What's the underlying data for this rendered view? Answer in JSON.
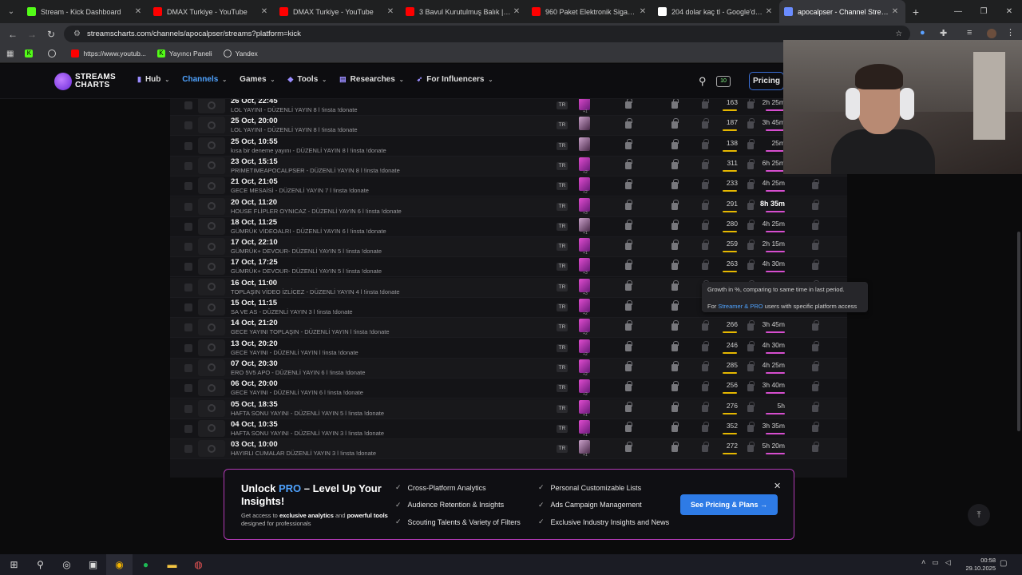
{
  "browser": {
    "tabs": [
      {
        "title": "Stream - Kick Dashboard",
        "color": "#53fc18"
      },
      {
        "title": "DMAX Turkiye - YouTube",
        "color": "#ff0000"
      },
      {
        "title": "DMAX Turkiye - YouTube",
        "color": "#ff0000"
      },
      {
        "title": "3 Bavul Kurutulmuş Balık | Güm",
        "color": "#ff0000"
      },
      {
        "title": "960 Paket Elektronik Sigara Tüt",
        "color": "#ff0000"
      },
      {
        "title": "204 dolar kaç tl - Google'da Ar",
        "color": "#ffffff"
      },
      {
        "title": "apocalpser - Channel Streams",
        "color": "#6a8cff"
      }
    ],
    "url": "streamscharts.com/channels/apocalpser/streams?platform=kick",
    "bookmarks": [
      "https://www.youtub...",
      "Yayıncı Paneli",
      "Yandex"
    ]
  },
  "header": {
    "logo_line1": "STREAMS",
    "logo_line2": "CHARTS",
    "nav": [
      {
        "label": "Hub",
        "icon": "bar-chart-icon"
      },
      {
        "label": "Channels",
        "icon": ""
      },
      {
        "label": "Games",
        "icon": ""
      },
      {
        "label": "Tools",
        "icon": "diamond-icon"
      },
      {
        "label": "Researches",
        "icon": "document-icon"
      },
      {
        "label": "For Influencers",
        "icon": "rocket-icon"
      }
    ],
    "badge": "10",
    "pricing": "Pricing"
  },
  "streams": [
    {
      "date": "26 Oct, 22:45",
      "title": "LOL YAYINI - DÜZENLİ YAYIN 8 l !insta !donate",
      "lang": "TR",
      "games": "+1",
      "viewers": "163",
      "duration": "2h 25m"
    },
    {
      "date": "25 Oct, 20:00",
      "title": "LOL YAYINI - DÜZENLİ YAYIN 8 l !insta !donate",
      "lang": "TR",
      "games": "",
      "viewers": "187",
      "duration": "3h 45m"
    },
    {
      "date": "25 Oct, 10:55",
      "title": "kısa bir deneme yayını - DÜZENLİ YAYIN 8 l !insta !donate",
      "lang": "TR",
      "games": "",
      "viewers": "138",
      "duration": "25m"
    },
    {
      "date": "23 Oct, 15:15",
      "title": "PRIMETIMEAPOCALPSER - DÜZENLİ YAYIN 8 l !insta !donate",
      "lang": "TR",
      "games": "+2",
      "viewers": "311",
      "duration": "6h 25m"
    },
    {
      "date": "21 Oct, 21:05",
      "title": "GECE MESAİSİ - DÜZENLİ YAYIN 7 l !insta !donate",
      "lang": "TR",
      "games": "+2",
      "viewers": "233",
      "duration": "4h 25m"
    },
    {
      "date": "20 Oct, 11:20",
      "title": "HOUSE FLİPLER OYNICAZ - DÜZENLİ YAYIN 6 l !insta !donate",
      "lang": "TR",
      "games": "+3",
      "viewers": "291",
      "duration": "8h 35m"
    },
    {
      "date": "18 Oct, 11:25",
      "title": "GÜMRÜK VİDEOALRI - DÜZENLİ YAYIN 6 l !insta !donate",
      "lang": "TR",
      "games": "+1",
      "viewers": "280",
      "duration": "4h 25m"
    },
    {
      "date": "17 Oct, 22:10",
      "title": "GÜMRÜK+ DEVOUR- DÜZENLİ YAYIN 5 l !insta !donate",
      "lang": "TR",
      "games": "+1",
      "viewers": "259",
      "duration": "2h 15m"
    },
    {
      "date": "17 Oct, 17:25",
      "title": "GÜMRÜK+ DEVOUR- DÜZENLİ YAYIN 5 l !insta !donate",
      "lang": "TR",
      "games": "+3",
      "viewers": "263",
      "duration": "4h 30m"
    },
    {
      "date": "16 Oct, 11:00",
      "title": "TOPLAŞIN VİDEO İZLİCEZ - DÜZENLİ YAYIN 4 l !insta !donate",
      "lang": "TR",
      "games": "+3",
      "viewers": "",
      "duration": ""
    },
    {
      "date": "15 Oct, 11:15",
      "title": "SA VE AS - DÜZENLİ YAYIN 3 l !insta !donate",
      "lang": "TR",
      "games": "+2",
      "viewers": "",
      "duration": ""
    },
    {
      "date": "14 Oct, 21:20",
      "title": "GECE YAYINI TOPLAŞIN - DÜZENLİ YAYIN l !insta !donate",
      "lang": "TR",
      "games": "+2",
      "viewers": "266",
      "duration": "3h 45m"
    },
    {
      "date": "13 Oct, 20:20",
      "title": "GECE YAYINI - DÜZENLİ YAYIN l !insta !donate",
      "lang": "TR",
      "games": "+2",
      "viewers": "246",
      "duration": "4h 30m"
    },
    {
      "date": "07 Oct, 20:30",
      "title": "ERO 5V5 APO - DÜZENLİ YAYIN 6 l !insta !donate",
      "lang": "TR",
      "games": "+2",
      "viewers": "285",
      "duration": "4h 25m"
    },
    {
      "date": "06 Oct, 20:00",
      "title": "GECE YAYINI - DÜZENLİ YAYIN 6 l !insta !donate",
      "lang": "TR",
      "games": "+2",
      "viewers": "256",
      "duration": "3h 40m"
    },
    {
      "date": "05 Oct, 18:35",
      "title": "HAFTA SONU YAYINI - DÜZENLİ YAYIN 5 l !insta !donate",
      "lang": "TR",
      "games": "+1",
      "viewers": "276",
      "duration": "5h"
    },
    {
      "date": "04 Oct, 10:35",
      "title": "HAFTA SONU YAYINI - DÜZENLİ YAYIN 3 l !insta !donate",
      "lang": "TR",
      "games": "+1",
      "viewers": "352",
      "duration": "3h 35m"
    },
    {
      "date": "03 Oct, 10:00",
      "title": "HAYIRLI CUMALAR DÜZENLİ YAYIN 3 l !insta !donate",
      "lang": "TR",
      "games": "+1",
      "viewers": "272",
      "duration": "5h 20m"
    }
  ],
  "tooltip": {
    "line1": "Growth in %, comparing to same time in last period.",
    "line2_pre": "For ",
    "line2_link": "Streamer & PRO",
    "line2_post": " users with specific platform access"
  },
  "promo": {
    "heading_a": "Unlock ",
    "heading_pro": "PRO",
    "heading_b": " – Level Up Your Insights!",
    "sub_a": "Get access to ",
    "sub_b": "exclusive analytics",
    "sub_c": " and ",
    "sub_d": "powerful tools",
    "sub_e": " designed for professionals",
    "features_left": [
      "Cross-Platform Analytics",
      "Audience Retention & Insights",
      "Scouting Talents & Variety of Filters"
    ],
    "features_right": [
      "Personal Customizable Lists",
      "Ads Campaign Management",
      "Exclusive Industry Insights and News"
    ],
    "cta": "See Pricing & Plans →"
  },
  "taskbar": {
    "time": "00:58",
    "date": "29.10.2025"
  }
}
